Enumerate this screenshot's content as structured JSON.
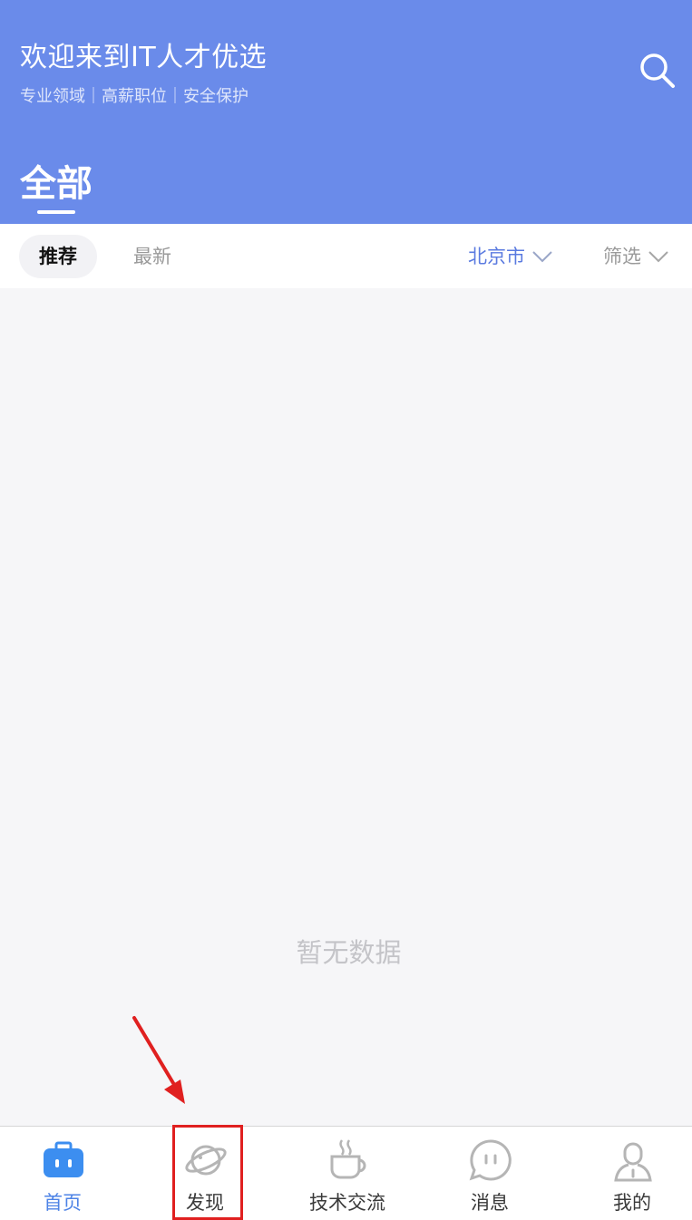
{
  "header": {
    "title": "欢迎来到IT人才优选",
    "subtitle": "专业领域｜高薪职位｜安全保护",
    "search_icon": "search-icon",
    "category_tab": "全部"
  },
  "filter_bar": {
    "sort_tabs": [
      {
        "label": "推荐",
        "active": true
      },
      {
        "label": "最新",
        "active": false
      }
    ],
    "city": "北京市",
    "filter": "筛选"
  },
  "content": {
    "empty_text": "暂无数据"
  },
  "tabbar": {
    "items": [
      {
        "label": "首页",
        "icon": "briefcase-icon",
        "active": true
      },
      {
        "label": "发现",
        "icon": "planet-icon",
        "active": false
      },
      {
        "label": "技术交流",
        "icon": "coffee-cup-icon",
        "active": false
      },
      {
        "label": "消息",
        "icon": "chat-bubble-icon",
        "active": false
      },
      {
        "label": "我的",
        "icon": "user-icon",
        "active": false
      }
    ]
  },
  "colors": {
    "header_bg": "#6a8bea",
    "accent": "#5b7be0",
    "active_tab": "#4d83e6",
    "annotation_red": "#e02020"
  }
}
